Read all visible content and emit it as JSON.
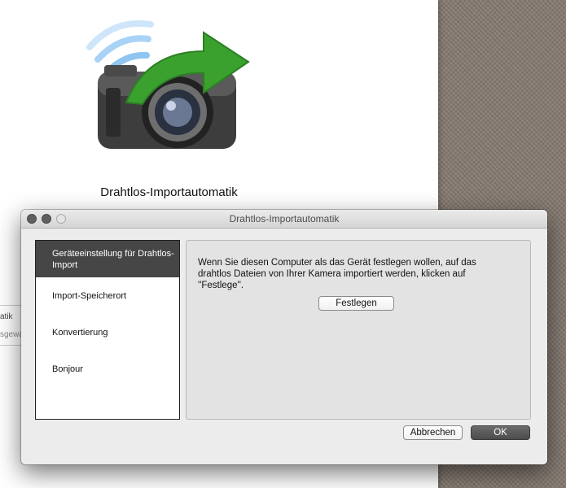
{
  "background_app": {
    "title": "Drahtlos-Importautomatik",
    "partial_text_1": "atik",
    "partial_text_2": "sgewä"
  },
  "dialog": {
    "window_title": "Drahtlos-Importautomatik",
    "sidebar": {
      "items": [
        {
          "label": "Geräteeinstellung für Drahtlos-Import",
          "active": true
        },
        {
          "label": "Import-Speicherort",
          "active": false
        },
        {
          "label": "Konvertierung",
          "active": false
        },
        {
          "label": "Bonjour",
          "active": false
        }
      ]
    },
    "panel": {
      "description": "Wenn Sie diesen Computer als das Gerät festlegen wollen, auf das drahtlos Dateien von Ihrer Kamera importiert werden, klicken auf ''Festlege''.",
      "set_button_label": "Festlegen"
    },
    "cancel_button_label": "Abbrechen",
    "ok_button_label": "OK"
  },
  "icons": {
    "hero": "camera-wifi-arrow-icon"
  },
  "colors": {
    "active_sidebar": "#464646",
    "ok_button": "#555555",
    "desktop": "#857a70",
    "arrow_green": "#3aa12f",
    "wifi_blue": "#8fc5f0"
  }
}
